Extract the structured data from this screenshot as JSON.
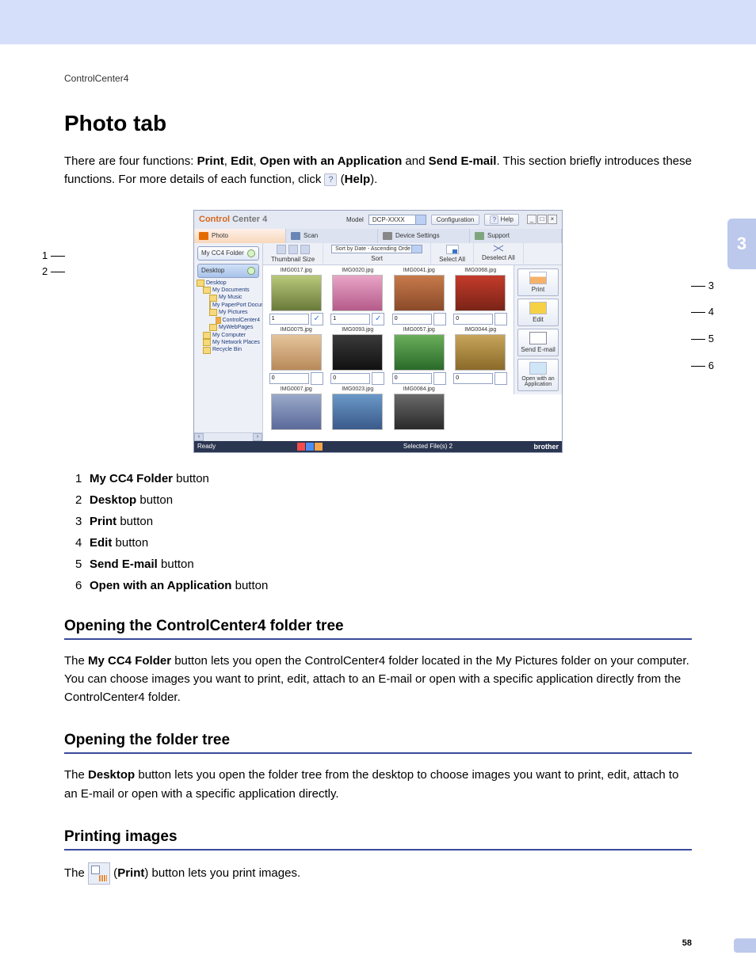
{
  "header_label": "ControlCenter4",
  "side_chapter": "3",
  "title": "Photo tab",
  "intro1": "There are four functions: ",
  "intro_b1": "Print",
  "intro_sep": ", ",
  "intro_b2": "Edit",
  "intro_b3": "Open with an Application",
  "intro_and": " and ",
  "intro_b4": "Send E-mail",
  "intro2": ". This section briefly introduces these functions. For more details of each function, click ",
  "intro_help": " (",
  "intro_help_b": "Help",
  "intro_help_end": ").",
  "app": {
    "brand1": "Control",
    "brand2": " Center 4",
    "model_label": "Model",
    "model_value": "DCP-XXXX",
    "config": "Configuration",
    "help": "Help",
    "tabs": [
      "Photo",
      "Scan",
      "Device Settings",
      "Support"
    ],
    "sb_mycc4": "My CC4 Folder",
    "sb_desktop": "Desktop",
    "tree": [
      "Desktop",
      "My Documents",
      "My Music",
      "My PaperPort Documents",
      "My Pictures",
      "ControlCenter4",
      "MyWebPages",
      "My Computer",
      "My Network Places",
      "Recycle Bin"
    ],
    "tool_thumb": "Thumbnail Size",
    "tool_sort": "Sort",
    "tool_sort_val": "Sort by Date - Ascending Orde",
    "tool_selall": "Select All",
    "tool_desall": "Deselect All",
    "files": [
      "IMG0017.jpg",
      "IMG0020.jpg",
      "IMG0041.jpg",
      "IMG0068.jpg",
      "IMG0075.jpg",
      "IMG0093.jpg",
      "IMG0057.jpg",
      "IMG0044.jpg",
      "IMG0007.jpg",
      "IMG0023.jpg",
      "IMG0084.jpg"
    ],
    "qty": [
      "1",
      "1",
      "0",
      "0",
      "0",
      "0",
      "0",
      "0"
    ],
    "checked": [
      true,
      true,
      false,
      false,
      false,
      false,
      false,
      false
    ],
    "actions": {
      "print": "Print",
      "edit": "Edit",
      "email": "Send E-mail",
      "openwith": "Open with an Application"
    },
    "status_ready": "Ready",
    "status_selected": "Selected File(s) 2",
    "brother": "brother"
  },
  "callouts": {
    "c1": "1",
    "c2": "2",
    "c3": "3",
    "c4": "4",
    "c5": "5",
    "c6": "6"
  },
  "legend": [
    {
      "n": "1",
      "b": "My CC4 Folder",
      "t": " button"
    },
    {
      "n": "2",
      "b": "Desktop",
      "t": " button"
    },
    {
      "n": "3",
      "b": "Print",
      "t": " button"
    },
    {
      "n": "4",
      "b": "Edit",
      "t": " button"
    },
    {
      "n": "5",
      "b": "Send E-mail",
      "t": " button"
    },
    {
      "n": "6",
      "b": "Open with an Application",
      "t": " button"
    }
  ],
  "sec1": {
    "h": "Opening the ControlCenter4 folder tree",
    "t1": "The ",
    "b": "My CC4 Folder",
    "t2": " button lets you open the ControlCenter4 folder located in the My Pictures folder on your computer. You can choose images you want to print, edit, attach to an E-mail or open with a specific application directly from the ControlCenter4 folder."
  },
  "sec2": {
    "h": "Opening the folder tree",
    "t1": "The ",
    "b": "Desktop",
    "t2": " button lets you open the folder tree from the desktop to choose images you want to print, edit, attach to an E-mail or open with a specific application directly."
  },
  "sec3": {
    "h": "Printing images",
    "t1": "The ",
    "t2": " (",
    "b": "Print",
    "t3": ") button lets you print images."
  },
  "page_number": "58",
  "help_glyph": "?"
}
